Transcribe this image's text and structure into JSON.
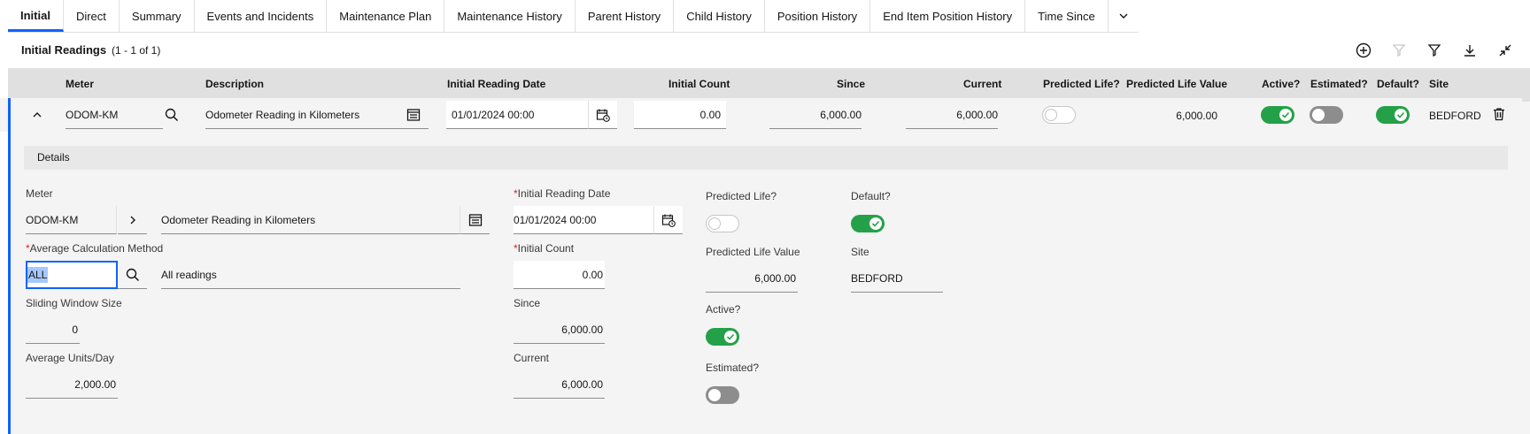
{
  "tabs": [
    {
      "label": "Initial",
      "active": true
    },
    {
      "label": "Direct"
    },
    {
      "label": "Summary"
    },
    {
      "label": "Events and Incidents"
    },
    {
      "label": "Maintenance Plan"
    },
    {
      "label": "Maintenance History"
    },
    {
      "label": "Parent History"
    },
    {
      "label": "Child History"
    },
    {
      "label": "Position History"
    },
    {
      "label": "End Item Position History"
    },
    {
      "label": "Time Since"
    }
  ],
  "table": {
    "title": "Initial Readings",
    "count": "(1 - 1 of 1)",
    "columns": {
      "meter": "Meter",
      "description": "Description",
      "initial_reading_date": "Initial Reading Date",
      "initial_count": "Initial Count",
      "since": "Since",
      "current": "Current",
      "predicted_life": "Predicted Life?",
      "predicted_life_value": "Predicted Life Value",
      "active": "Active?",
      "estimated": "Estimated?",
      "default": "Default?",
      "site": "Site"
    },
    "row": {
      "meter": "ODOM-KM",
      "description": "Odometer Reading in Kilometers",
      "initial_reading_date": "01/01/2024 00:00",
      "initial_count": "0.00",
      "since": "6,000.00",
      "current": "6,000.00",
      "predicted_life": false,
      "predicted_life_value": "6,000.00",
      "active": true,
      "estimated": false,
      "default": true,
      "site": "BEDFORD"
    }
  },
  "details": {
    "header": "Details",
    "meter_label": "Meter",
    "meter_value": "ODOM-KM",
    "meter_description": "Odometer Reading in Kilometers",
    "avg_calc_label": "Average Calculation Method",
    "avg_calc_value": "ALL",
    "avg_calc_description": "All readings",
    "sliding_window_label": "Sliding Window Size",
    "sliding_window_value": "0",
    "avg_units_label": "Average Units/Day",
    "avg_units_value": "2,000.00",
    "initial_date_label": "Initial Reading Date",
    "initial_date_value": "01/01/2024 00:00",
    "initial_count_label": "Initial Count",
    "initial_count_value": "0.00",
    "since_label": "Since",
    "since_value": "6,000.00",
    "current_label": "Current",
    "current_value": "6,000.00",
    "predicted_life_label": "Predicted Life?",
    "predicted_life_value_label": "Predicted Life Value",
    "predicted_life_value": "6,000.00",
    "active_label": "Active?",
    "estimated_label": "Estimated?",
    "default_label": "Default?",
    "site_label": "Site",
    "site_value": "BEDFORD",
    "required_mark": "*"
  },
  "colors": {
    "accent": "#0f62fe",
    "toggle_on": "#24a148",
    "required": "#da1e28"
  }
}
